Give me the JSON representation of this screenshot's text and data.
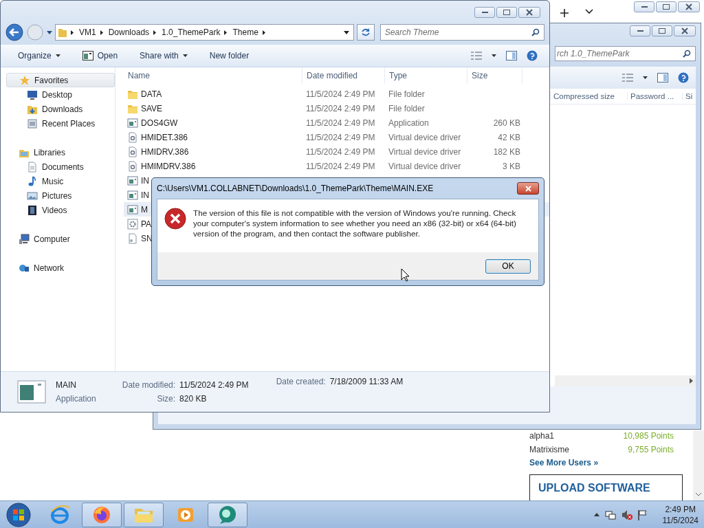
{
  "browser": {
    "leaderboard": [
      {
        "user": "alpha1",
        "points": "10,985 Points"
      },
      {
        "user": "Matrixisme",
        "points": "9,755 Points"
      }
    ],
    "more_link": "See More Users »",
    "upload_heading": "UPLOAD SOFTWARE"
  },
  "back_window": {
    "search": {
      "placeholder": "rch 1.0_ThemePark"
    },
    "columns": [
      "Compressed size",
      "Password ...",
      "Si"
    ]
  },
  "explorer": {
    "breadcrumb": [
      "VM1",
      "Downloads",
      "1.0_ThemePark",
      "Theme"
    ],
    "search": {
      "placeholder": "Search Theme"
    },
    "toolbar": [
      {
        "label": "Organize",
        "kind": "menu"
      },
      {
        "label": "Open",
        "kind": "icon"
      },
      {
        "label": "Share with",
        "kind": "menu"
      },
      {
        "label": "New folder",
        "kind": "plain"
      }
    ],
    "nav": [
      {
        "label": "Favorites",
        "kind": "favorites",
        "selected": true,
        "children": [
          {
            "label": "Desktop",
            "kind": "desktop",
            "selected": false
          },
          {
            "label": "Downloads",
            "kind": "downloads",
            "selected": false
          },
          {
            "label": "Recent Places",
            "kind": "recent",
            "selected": false
          }
        ]
      },
      {
        "label": "Libraries",
        "kind": "libraries",
        "selected": false,
        "children": [
          {
            "label": "Documents",
            "kind": "documents",
            "selected": false
          },
          {
            "label": "Music",
            "kind": "music",
            "selected": false
          },
          {
            "label": "Pictures",
            "kind": "pictures",
            "selected": false
          },
          {
            "label": "Videos",
            "kind": "videos",
            "selected": false
          }
        ]
      },
      {
        "label": "Computer",
        "kind": "computer",
        "selected": false
      },
      {
        "label": "Network",
        "kind": "network",
        "selected": false
      }
    ],
    "columns": [
      "Name",
      "Date modified",
      "Type",
      "Size"
    ],
    "files": [
      {
        "name": "DATA",
        "kind": "folder",
        "modified": "11/5/2024 2:49 PM",
        "type": "File folder",
        "selected": false
      },
      {
        "name": "SAVE",
        "kind": "folder",
        "modified": "11/5/2024 2:49 PM",
        "type": "File folder",
        "selected": false
      },
      {
        "name": "DOS4GW",
        "kind": "app",
        "modified": "11/5/2024 2:49 PM",
        "type": "Application",
        "size": "260 KB",
        "selected": false
      },
      {
        "name": "HMIDET.386",
        "kind": "driver",
        "modified": "11/5/2024 2:49 PM",
        "type": "Virtual device driver",
        "size": "42 KB",
        "selected": false
      },
      {
        "name": "HMIDRV.386",
        "kind": "driver",
        "modified": "11/5/2024 2:49 PM",
        "type": "Virtual device driver",
        "size": "182 KB",
        "selected": false
      },
      {
        "name": "HMIMDRV.386",
        "kind": "driver",
        "modified": "11/5/2024 2:49 PM",
        "type": "Virtual device driver",
        "size": "3 KB",
        "selected": false
      },
      {
        "name": "IN",
        "kind": "app",
        "selected": false
      },
      {
        "name": "IN",
        "kind": "app",
        "selected": false
      },
      {
        "name": "M",
        "kind": "app",
        "selected": true
      },
      {
        "name": "PA",
        "kind": "settings",
        "selected": false
      },
      {
        "name": "SN",
        "kind": "file",
        "selected": false
      }
    ],
    "details": {
      "name": "MAIN",
      "type": "Application",
      "fields": [
        {
          "label": "Date modified:",
          "value": "11/5/2024 2:49 PM"
        },
        {
          "label": "Size:",
          "value": "820 KB"
        },
        {
          "label": "Date created:",
          "value": "7/18/2009 11:33 AM"
        }
      ]
    }
  },
  "dialog": {
    "title": "C:\\Users\\VM1.COLLABNET\\Downloads\\1.0_ThemePark\\Theme\\MAIN.EXE",
    "message": "The version of this file is not compatible with the version of Windows you're running. Check your computer's system information to see whether you need an x86 (32-bit) or x64 (64-bit) version of the program, and then contact the software publisher.",
    "buttons": [
      "OK"
    ]
  },
  "taskbar": {
    "apps": [
      {
        "kind": "ie",
        "active": false
      },
      {
        "kind": "firefox",
        "active": true
      },
      {
        "kind": "explorer",
        "active": true
      },
      {
        "kind": "media",
        "active": false
      },
      {
        "kind": "chat",
        "active": true
      }
    ],
    "time": "2:49 PM",
    "date": "11/5/2024"
  }
}
